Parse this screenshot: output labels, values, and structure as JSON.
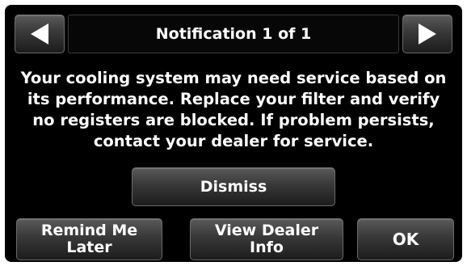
{
  "header": {
    "title": "Notification 1 of 1",
    "prev_icon": "arrow-left-icon",
    "next_icon": "arrow-right-icon"
  },
  "message": {
    "text": "Your cooling system may need service based on\nits performance. Replace your filter and verify\nno registers are blocked. If problem persists,\ncontact your dealer for service."
  },
  "actions": {
    "dismiss_label": "Dismiss",
    "remind_label": "Remind Me\nLater",
    "dealer_label": "View Dealer\nInfo",
    "ok_label": "OK"
  },
  "colors": {
    "background": "#000000",
    "text": "#ffffff",
    "button_top": "#5a5a5a",
    "button_bottom": "#1c1c1c"
  }
}
